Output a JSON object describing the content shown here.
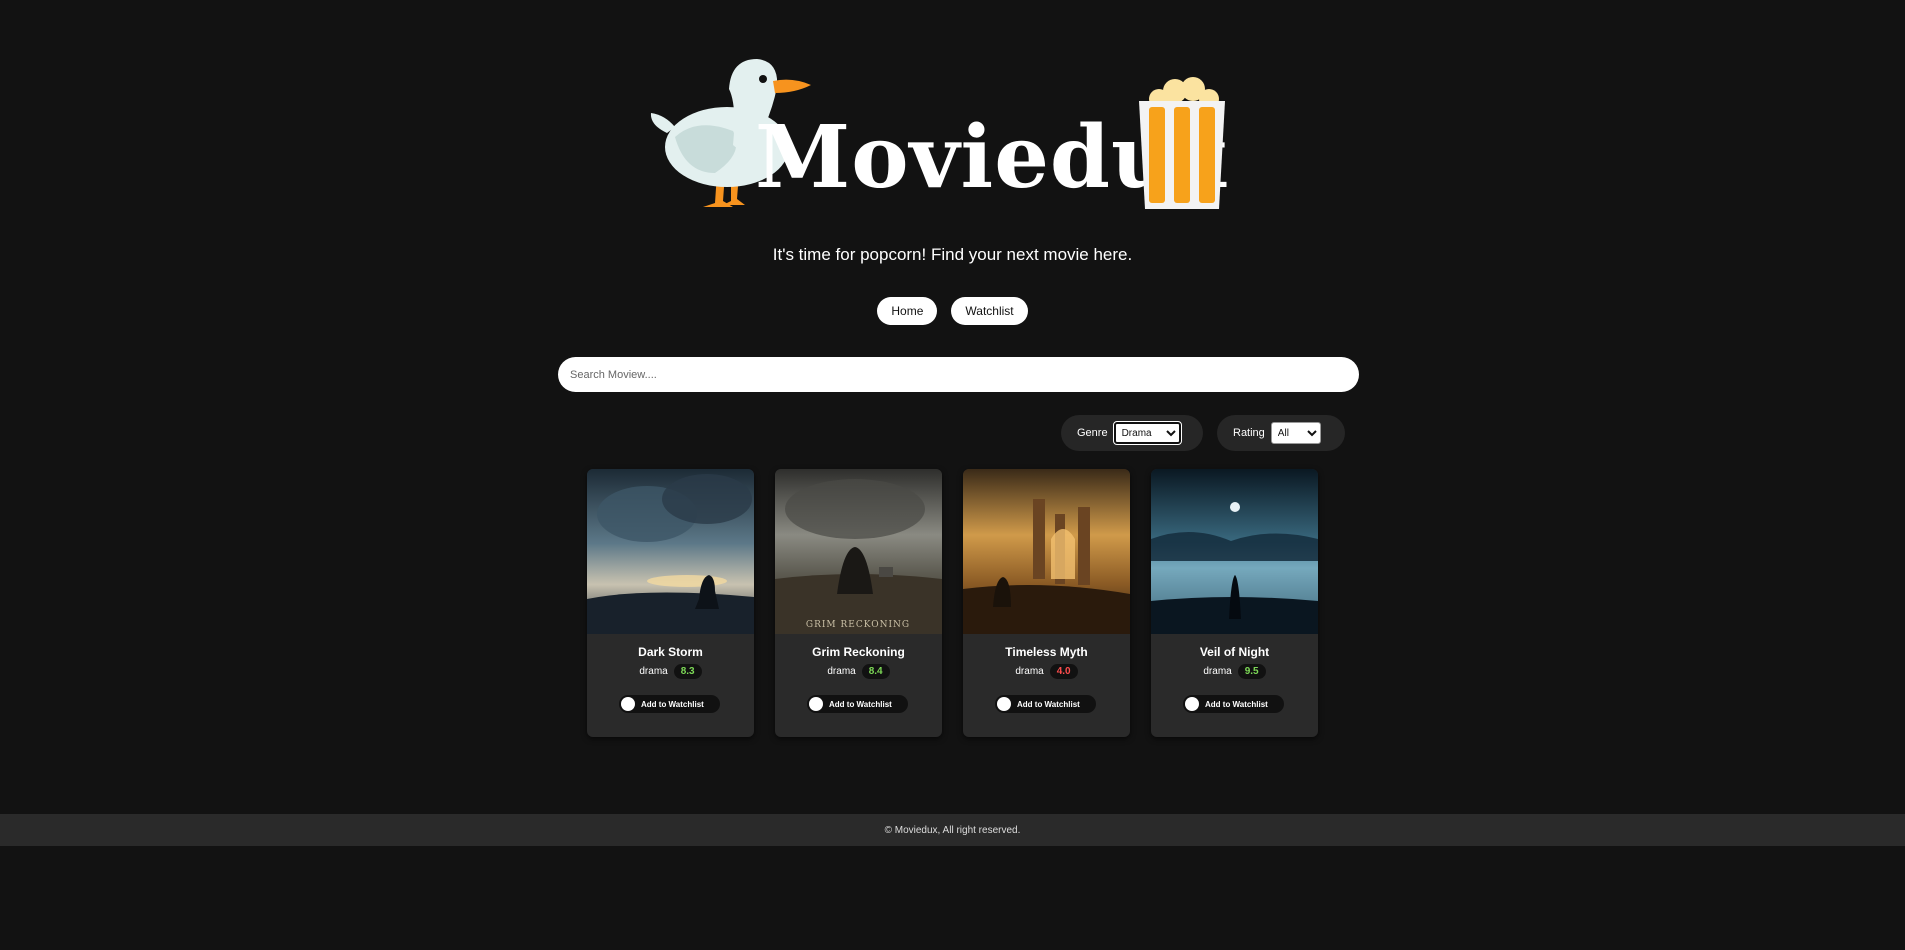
{
  "brand": {
    "name": "Moviedux"
  },
  "tagline": "It's time for popcorn! Find your next movie here.",
  "nav": {
    "home": "Home",
    "watchlist": "Watchlist"
  },
  "search": {
    "placeholder": "Search Moview....",
    "value": ""
  },
  "filters": {
    "genre": {
      "label": "Genre",
      "selected": "Drama"
    },
    "rating": {
      "label": "Rating",
      "selected": "All"
    }
  },
  "colors": {
    "background": "#121212",
    "card": "#2a2a2a",
    "rating_good": "#7dd957",
    "rating_bad": "#ff4d4d",
    "duck_orange": "#f7931e",
    "popcorn_orange": "#f7a21b"
  },
  "movies": [
    {
      "title": "Dark Storm",
      "genre": "drama",
      "rating": "8.3",
      "rating_color": "#7dd957",
      "action": "Add to Watchlist"
    },
    {
      "title": "Grim Reckoning",
      "genre": "drama",
      "rating": "8.4",
      "rating_color": "#7dd957",
      "action": "Add to Watchlist",
      "poster_text": "GRIM RECKONING"
    },
    {
      "title": "Timeless Myth",
      "genre": "drama",
      "rating": "4.0",
      "rating_color": "#ff4d4d",
      "action": "Add to Watchlist"
    },
    {
      "title": "Veil of Night",
      "genre": "drama",
      "rating": "9.5",
      "rating_color": "#7dd957",
      "action": "Add to Watchlist"
    }
  ],
  "footer": "© Moviedux, All right reserved."
}
